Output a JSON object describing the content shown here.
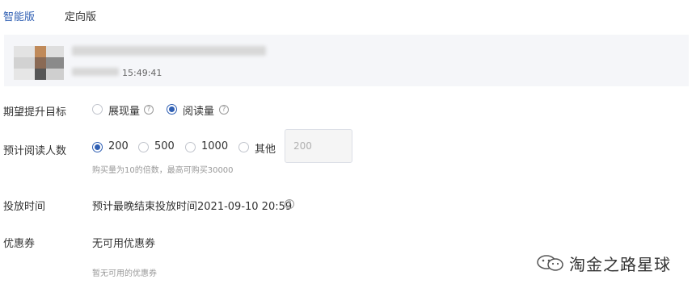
{
  "tabs": [
    {
      "label": "智能版",
      "active": true
    },
    {
      "label": "定向版",
      "active": false
    }
  ],
  "article": {
    "time": "15:49:41"
  },
  "goal": {
    "label": "期望提升目标",
    "options": [
      {
        "label": "展现量",
        "checked": false
      },
      {
        "label": "阅读量",
        "checked": true
      }
    ]
  },
  "readers": {
    "label": "预计阅读人数",
    "options": [
      {
        "label": "200",
        "checked": true
      },
      {
        "label": "500",
        "checked": false
      },
      {
        "label": "1000",
        "checked": false
      },
      {
        "label": "其他",
        "checked": false
      }
    ],
    "other_placeholder": "200",
    "hint": "购买量为10的倍数，最高可购买30000"
  },
  "delivery": {
    "label": "投放时间",
    "value": "预计最晚结束投放时间2021-09-10 20:59"
  },
  "coupon": {
    "label": "优惠券",
    "value": "无可用优惠券",
    "hint": "暂无可用的优惠券"
  },
  "watermark": {
    "text": "淘金之路星球",
    "icon": "wechat-icon"
  },
  "colors": {
    "accent": "#2f5fb3",
    "card_bg": "#f5f6f9"
  }
}
